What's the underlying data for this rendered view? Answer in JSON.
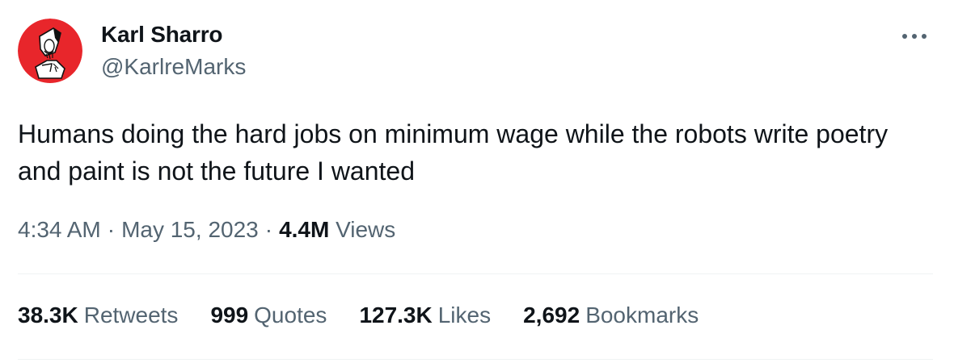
{
  "author": {
    "display_name": "Karl Sharro",
    "handle": "@KarlreMarks",
    "avatar_icon": "avatar-illustration-icon"
  },
  "more_icon": "more-options-icon",
  "tweet": {
    "text": "Humans doing the hard jobs on minimum wage while the robots write poetry and paint is not the future I wanted"
  },
  "meta": {
    "time": "4:34 AM",
    "separator": "·",
    "date": "May 15, 2023",
    "views_count": "4.4M",
    "views_label": "Views"
  },
  "stats": [
    {
      "count": "38.3K",
      "label": "Retweets"
    },
    {
      "count": "999",
      "label": "Quotes"
    },
    {
      "count": "127.3K",
      "label": "Likes"
    },
    {
      "count": "2,692",
      "label": "Bookmarks"
    }
  ],
  "colors": {
    "text_primary": "#0f1419",
    "text_secondary": "#536471",
    "divider": "#eff3f4",
    "avatar_bg": "#e8262b"
  }
}
